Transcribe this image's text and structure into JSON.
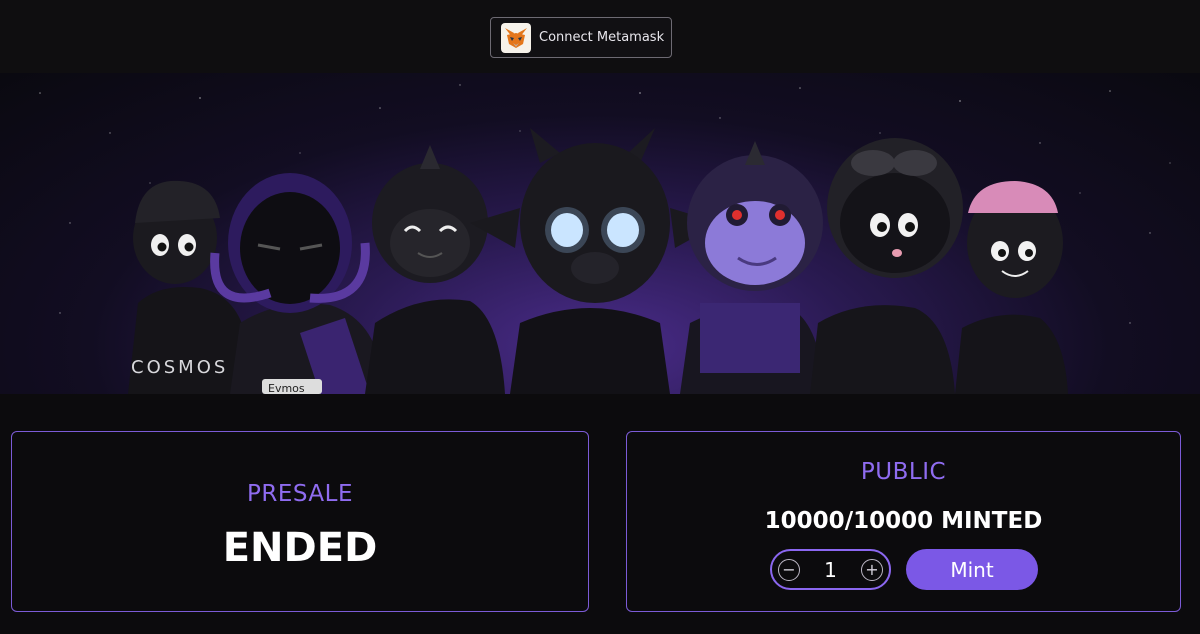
{
  "header": {
    "connect_label": "Connect Metamask",
    "connect_icon": "metamask-fox-icon"
  },
  "banner": {
    "alt_text_visible": "COSMOS",
    "badge_text": "Evmos"
  },
  "presale": {
    "label": "PRESALE",
    "status": "ENDED"
  },
  "public": {
    "label": "PUBLIC",
    "minted": "10000/10000 MINTED",
    "quantity": "1",
    "decrement_symbol": "−",
    "increment_symbol": "+",
    "mint_label": "Mint"
  },
  "colors": {
    "accent": "#7b58e6",
    "label_purple": "#8f6cf0",
    "background": "#0c0b0d"
  }
}
